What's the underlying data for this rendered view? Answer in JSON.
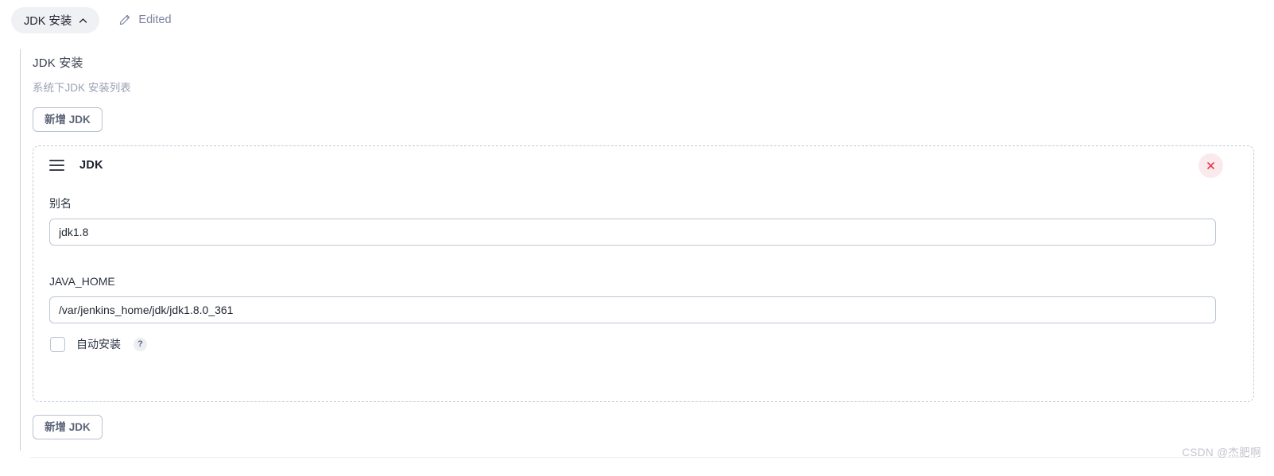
{
  "topbar": {
    "section_pill_label": "JDK 安装",
    "section_pill_icon": "chevron-up-icon",
    "edited_icon": "pencil-icon",
    "edited_label": "Edited"
  },
  "section": {
    "title": "JDK 安装",
    "subtitle": "系统下JDK 安装列表",
    "add_button_top_label": "新增 JDK",
    "add_button_bottom_label": "新增 JDK"
  },
  "jdk_block": {
    "drag_handle_icon": "hamburger-drag-icon",
    "title": "JDK",
    "close_icon": "close-x-icon",
    "fields": [
      {
        "label": "别名",
        "value": "jdk1.8",
        "placeholder": ""
      },
      {
        "label": "JAVA_HOME",
        "value": "/var/jenkins_home/jdk/jdk1.8.0_361",
        "placeholder": ""
      }
    ],
    "checkbox": {
      "label": "自动安装",
      "checked": false,
      "help_label": "?"
    }
  },
  "footer": {
    "watermark": "CSDN @杰肥啊"
  },
  "colors": {
    "pill_bg": "#f0f1f4",
    "muted_text": "#9aa1b4",
    "edited_text": "#7b82a0",
    "button_border": "#b9c2d0",
    "button_text": "#5c6478",
    "dashed_border": "#c2ccd8",
    "input_border": "#bcc7d2",
    "close_bg": "#fbeaed",
    "close_fg": "#e8374a",
    "rule": "#c8cfdb",
    "watermark": "#c3c5cc"
  }
}
